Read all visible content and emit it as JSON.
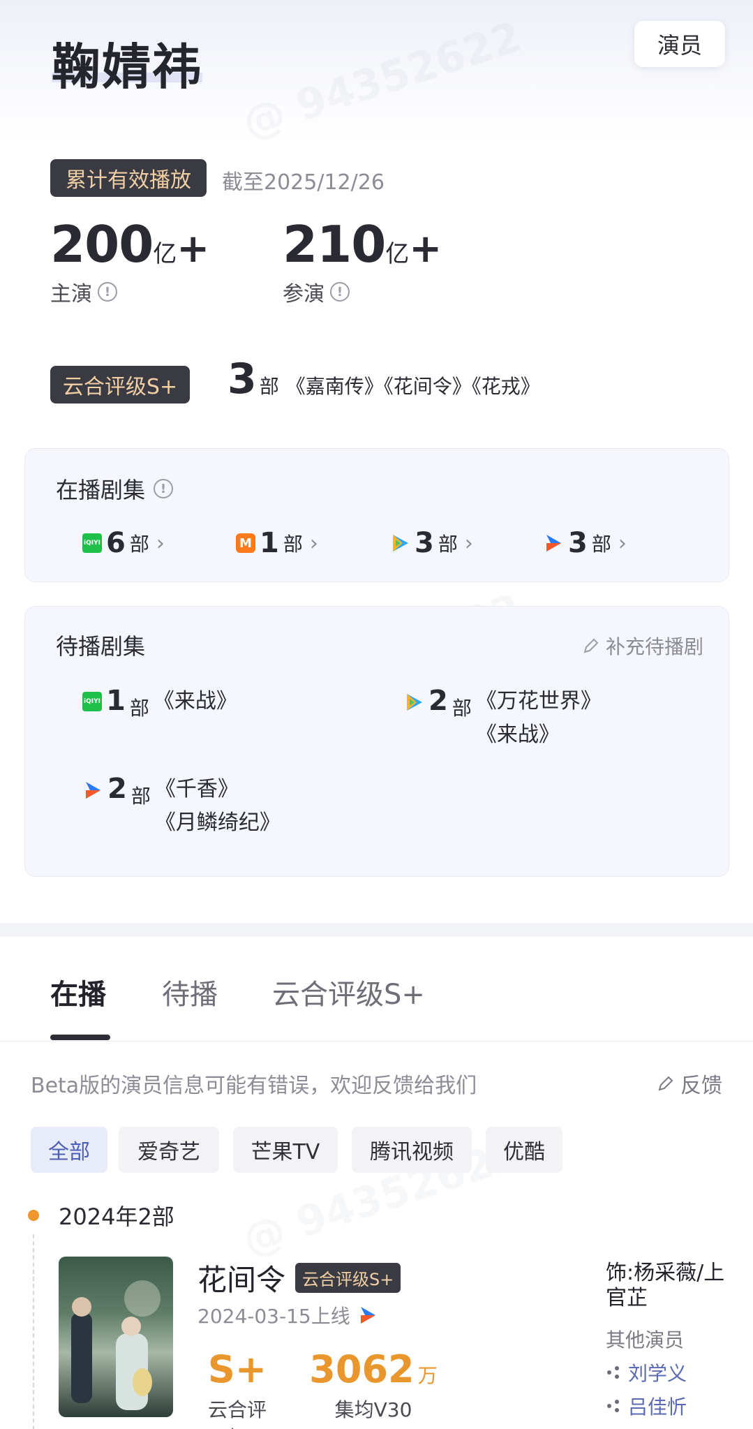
{
  "header": {
    "actor_name": "鞠婧祎",
    "role_button": "演员"
  },
  "cumulative": {
    "tag": "累计有效播放",
    "as_of": "截至2025/12/26",
    "lead": {
      "value": "200",
      "unit": "亿",
      "plus": "+",
      "label": "主演"
    },
    "support": {
      "value": "210",
      "unit": "亿",
      "plus": "+",
      "label": "参演"
    }
  },
  "rating": {
    "tag": "云合评级S+",
    "count": "3",
    "unit": "部",
    "titles": "《嘉南传》《花间令》《花戎》"
  },
  "airing": {
    "title": "在播剧集",
    "platforms": [
      {
        "icon": "iqiyi-icon",
        "count": "6",
        "unit": "部"
      },
      {
        "icon": "mango-tv-icon",
        "count": "1",
        "unit": "部"
      },
      {
        "icon": "tencent-video-icon",
        "count": "3",
        "unit": "部"
      },
      {
        "icon": "youku-icon",
        "count": "3",
        "unit": "部"
      }
    ]
  },
  "pending": {
    "title": "待播剧集",
    "action": "补充待播剧",
    "groups": [
      {
        "icon": "iqiyi-icon",
        "count": "1",
        "unit": "部",
        "titles": [
          "《来战》"
        ]
      },
      {
        "icon": "tencent-video-icon",
        "count": "2",
        "unit": "部",
        "titles": [
          "《万花世界》",
          "《来战》"
        ]
      },
      {
        "icon": "youku-icon",
        "count": "2",
        "unit": "部",
        "titles": [
          "《千香》",
          "《月鳞绮纪》"
        ]
      }
    ]
  },
  "tabs": [
    "在播",
    "待播",
    "云合评级S+"
  ],
  "notice": {
    "text": "Beta版的演员信息可能有错误，欢迎反馈给我们",
    "feedback": "反馈"
  },
  "filters": [
    "全部",
    "爱奇艺",
    "芒果TV",
    "腾讯视频",
    "优酷"
  ],
  "timeline": {
    "year_label": "2024年2部",
    "show": {
      "title": "花间令",
      "tag": "云合评级S+",
      "date": "2024-03-15上线",
      "rating_value": "S+",
      "rating_label": "云合评级",
      "views_value": "3062",
      "views_unit": "万",
      "views_label": "集均V30",
      "role": "饰:杨采薇/上官芷",
      "other_actors_label": "其他演员",
      "other_actors": [
        "刘学义",
        "吕佳忻"
      ]
    }
  },
  "colors": {
    "accent_orange": "#e9962c",
    "tag_dark": "#3a3a42",
    "tag_text": "#f1cfa4",
    "link_blue": "#5a6ab5"
  }
}
